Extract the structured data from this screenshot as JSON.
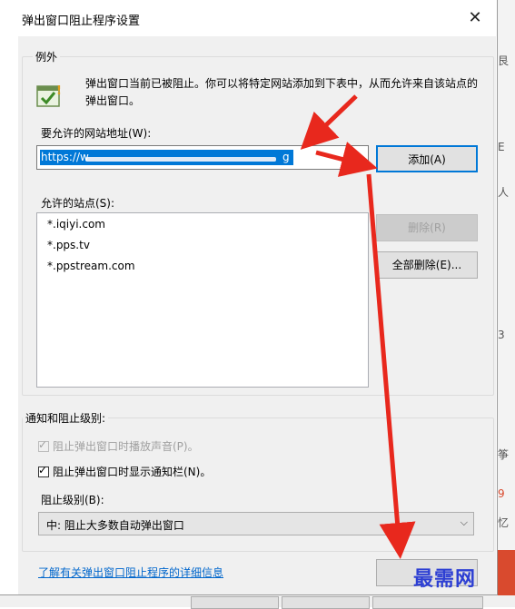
{
  "window": {
    "title": "弹出窗口阻止程序设置",
    "close_glyph": "✕"
  },
  "exceptions": {
    "legend": "例外",
    "description": "弹出窗口当前已被阻止。你可以将特定网站添加到下表中，从而允许来自该站点的弹出窗口。",
    "url_label": "要允许的网站地址(W):",
    "url_value_start": "https://w",
    "url_value_end": "g",
    "add_button": "添加(A)",
    "allowed_label": "允许的站点(S):",
    "allowed_sites": [
      "*.iqiyi.com",
      "*.pps.tv",
      "*.ppstream.com"
    ],
    "remove_button": "删除(R)",
    "remove_all_button": "全部删除(E)..."
  },
  "notifications": {
    "legend": "通知和阻止级别:",
    "play_sound": {
      "label": "阻止弹出窗口时播放声音(P)。",
      "checked": true,
      "enabled": false
    },
    "show_bar": {
      "label": "阻止弹出窗口时显示通知栏(N)。",
      "checked": true,
      "enabled": true
    },
    "level_label": "阻止级别(B):",
    "level_value": "中: 阻止大多数自动弹出窗口"
  },
  "footer": {
    "link": "了解有关弹出窗口阻止程序的详细信息",
    "close_button": ""
  },
  "watermark": "最需网",
  "background": {
    "side_chars": [
      "艮",
      "E",
      "人",
      "3",
      "筝",
      "9",
      "忆"
    ]
  },
  "colors": {
    "accent": "#0078d7",
    "arrow": "#e8281d",
    "watermark": "#2d3fd3"
  }
}
